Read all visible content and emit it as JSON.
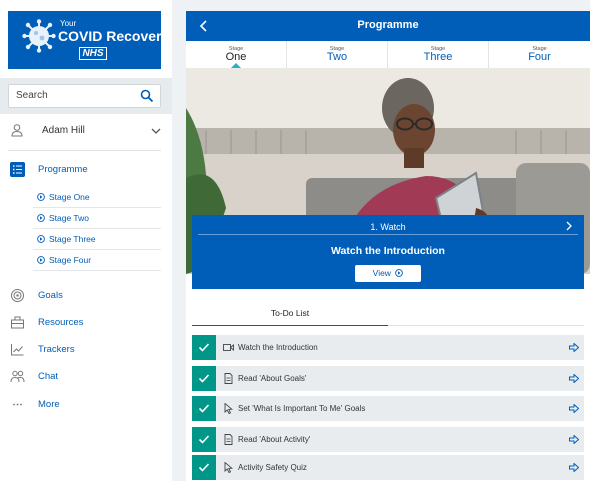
{
  "brand": {
    "your": "Your",
    "title": "COVID Recovery",
    "nhs": "NHS"
  },
  "search": {
    "placeholder": "Search"
  },
  "user": {
    "name": "Adam Hill"
  },
  "nav": {
    "programme": "Programme",
    "stages": [
      "Stage One",
      "Stage Two",
      "Stage Three",
      "Stage Four"
    ],
    "goals": "Goals",
    "resources": "Resources",
    "trackers": "Trackers",
    "chat": "Chat",
    "more": "More"
  },
  "main": {
    "title": "Programme",
    "stage_tabs": [
      {
        "label": "Stage",
        "name": "One",
        "active": true
      },
      {
        "label": "Stage",
        "name": "Two"
      },
      {
        "label": "Stage",
        "name": "Three"
      },
      {
        "label": "Stage",
        "name": "Four"
      }
    ],
    "card": {
      "step": "1. Watch",
      "heading": "Watch the Introduction",
      "button": "View"
    },
    "todo_tab": "To-Do List",
    "tasks": [
      {
        "icon": "video-icon",
        "label": "Watch the Introduction"
      },
      {
        "icon": "document-icon",
        "label": "Read 'About Goals'"
      },
      {
        "icon": "pointer-icon",
        "label": "Set 'What Is Important To Me' Goals"
      },
      {
        "icon": "document-icon",
        "label": "Read 'About Activity'"
      },
      {
        "icon": "pointer-icon",
        "label": "Activity Safety Quiz"
      }
    ]
  },
  "colors": {
    "nhs_blue": "#005eb8",
    "complete_green": "#009688",
    "panel_bg": "#e8ecef"
  }
}
